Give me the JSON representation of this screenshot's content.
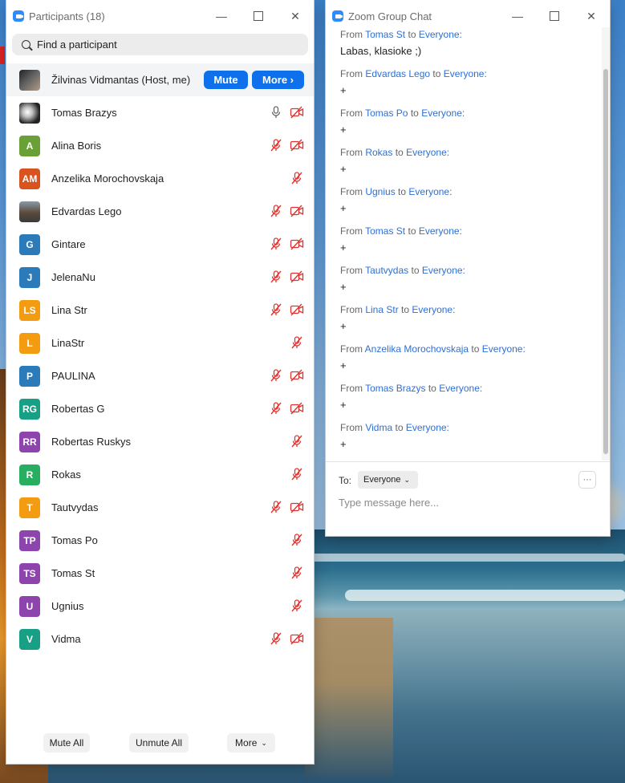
{
  "participants_window": {
    "title": "Participants (18)",
    "search_placeholder": "Find a participant",
    "host": {
      "name": "Žilvinas Vidmantas (Host, me)",
      "mute_label": "Mute",
      "more_label": "More ›"
    },
    "participants": [
      {
        "name": "Tomas Brazys",
        "initials": "",
        "avatar": "photo",
        "color": "",
        "mic": "on",
        "video": "off"
      },
      {
        "name": "Alina Boris",
        "initials": "A",
        "color": "#6aa136",
        "mic": "off",
        "video": "off"
      },
      {
        "name": "Anzelika Morochovskaja",
        "initials": "AM",
        "color": "#d9531e",
        "mic": "off",
        "video": "none"
      },
      {
        "name": "Edvardas Lego",
        "initials": "",
        "avatar": "photo",
        "color": "",
        "mic": "off",
        "video": "off"
      },
      {
        "name": "Gintare",
        "initials": "G",
        "color": "#2b7bba",
        "mic": "off",
        "video": "off"
      },
      {
        "name": "JelenaNu",
        "initials": "J",
        "color": "#2b7bba",
        "mic": "off",
        "video": "off"
      },
      {
        "name": "Lina Str",
        "initials": "LS",
        "color": "#f39c12",
        "mic": "off",
        "video": "off"
      },
      {
        "name": "LinaStr",
        "initials": "L",
        "color": "#f39c12",
        "mic": "off",
        "video": "none"
      },
      {
        "name": "PAULINA",
        "initials": "P",
        "color": "#2b7bba",
        "mic": "off",
        "video": "off"
      },
      {
        "name": "Robertas G",
        "initials": "RG",
        "color": "#17a085",
        "mic": "off",
        "video": "off"
      },
      {
        "name": "Robertas Ruskys",
        "initials": "RR",
        "color": "#8e44ad",
        "mic": "off",
        "video": "none"
      },
      {
        "name": "Rokas",
        "initials": "R",
        "color": "#27ae60",
        "mic": "off",
        "video": "none"
      },
      {
        "name": "Tautvydas",
        "initials": "T",
        "color": "#f39c12",
        "mic": "off",
        "video": "off"
      },
      {
        "name": "Tomas Po",
        "initials": "TP",
        "color": "#8e44ad",
        "mic": "off",
        "video": "none"
      },
      {
        "name": "Tomas St",
        "initials": "TS",
        "color": "#8e44ad",
        "mic": "off",
        "video": "none"
      },
      {
        "name": "Ugnius",
        "initials": "U",
        "color": "#8e44ad",
        "mic": "off",
        "video": "none"
      },
      {
        "name": "Vidma",
        "initials": "V",
        "color": "#17a085",
        "mic": "off",
        "video": "off"
      }
    ],
    "footer": {
      "mute_all": "Mute All",
      "unmute_all": "Unmute All",
      "more": "More"
    }
  },
  "chat_window": {
    "title": "Zoom Group Chat",
    "messages": [
      {
        "from": "Tomas St",
        "to": "Everyone:",
        "text": "Labas, klasioke ;)"
      },
      {
        "from": "Edvardas Lego",
        "to": "Everyone:",
        "text": "+"
      },
      {
        "from": "Tomas Po",
        "to": "Everyone:",
        "text": "+"
      },
      {
        "from": "Rokas",
        "to": "Everyone:",
        "text": "+"
      },
      {
        "from": "Ugnius",
        "to": "Everyone:",
        "text": "+"
      },
      {
        "from": "Tomas St",
        "to": "Everyone:",
        "text": "+"
      },
      {
        "from": "Tautvydas",
        "to": "Everyone:",
        "text": "+"
      },
      {
        "from": "Lina Str",
        "to": "Everyone:",
        "text": "+"
      },
      {
        "from": "Anzelika Morochovskaja",
        "to": "Everyone:",
        "text": "+"
      },
      {
        "from": "Tomas Brazys",
        "to": "Everyone:",
        "text": "+"
      },
      {
        "from": "Vidma",
        "to": "Everyone:",
        "text": "+"
      }
    ],
    "from_word": "From",
    "to_word": "to",
    "to_label": "To:",
    "recipient": "Everyone",
    "input_placeholder": "Type message here...",
    "more_options": "···"
  },
  "colors": {
    "accent": "#0e71eb",
    "muted_red": "#e0332f",
    "link_blue": "#2d6fd6"
  }
}
